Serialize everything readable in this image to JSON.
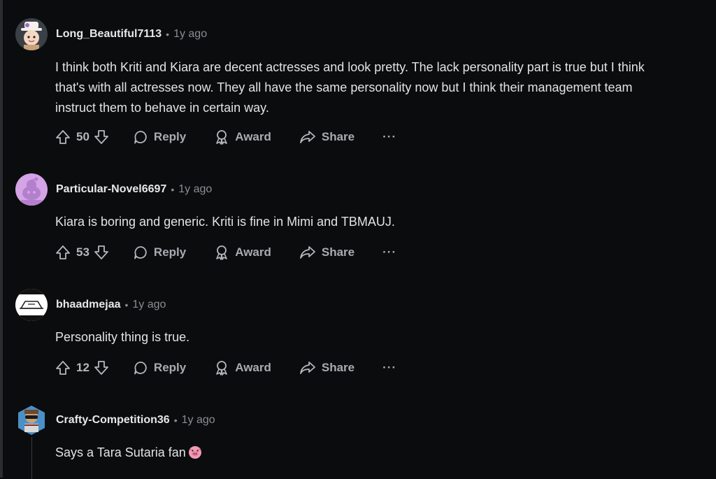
{
  "comments": [
    {
      "author": "Long_Beautiful7113",
      "time": "1y ago",
      "body_lines": [
        "I think both Kriti and Kiara are decent actresses and look pretty. The lack personality part is true but I think",
        "that's with all actresses now. They all have the same personality now but I think their management team",
        "instruct them to behave in certain way."
      ],
      "votes": "50",
      "reply": "Reply",
      "award": "Award",
      "share": "Share",
      "more": "···"
    },
    {
      "author": "Particular-Novel6697",
      "time": "1y ago",
      "body_lines": [
        "Kiara is boring and generic. Kriti is fine in Mimi and TBMAUJ."
      ],
      "votes": "53",
      "reply": "Reply",
      "award": "Award",
      "share": "Share",
      "more": "···"
    },
    {
      "author": "bhaadmejaa",
      "time": "1y ago",
      "body_lines": [
        "Personality thing is true."
      ],
      "votes": "12",
      "reply": "Reply",
      "award": "Award",
      "share": "Share",
      "more": "···"
    },
    {
      "author": "Crafty-Competition36",
      "time": "1y ago",
      "body_lines": [
        "Says a Tara Sutaria fan"
      ]
    }
  ],
  "separator": "•",
  "icons": {
    "upvote": "upvote-arrow-icon",
    "downvote": "downvote-arrow-icon",
    "reply": "speech-bubble-icon",
    "award": "award-ribbon-icon",
    "share": "share-arrow-icon",
    "emoji": "pig-face-emoji-icon"
  }
}
